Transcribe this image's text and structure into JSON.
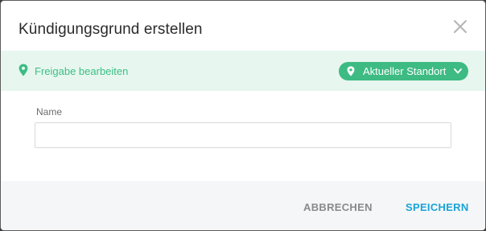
{
  "dialog": {
    "title": "Kündigungsgrund erstellen",
    "close_icon": "close-icon"
  },
  "banner": {
    "icon": "map-pin-icon",
    "text": "Freigabe bearbeiten",
    "location_pill": {
      "icon": "map-pin-icon",
      "label": "Aktueller Standort",
      "chevron_icon": "chevron-down-icon"
    }
  },
  "form": {
    "name_label": "Name",
    "name_value": "",
    "name_placeholder": ""
  },
  "footer": {
    "cancel_label": "ABBRECHEN",
    "save_label": "SPEICHERN"
  },
  "colors": {
    "accent_green": "#3dbb83",
    "banner_bg": "#e7f7ef",
    "save_blue": "#1aa3d8",
    "cancel_gray": "#8a8a8a"
  }
}
